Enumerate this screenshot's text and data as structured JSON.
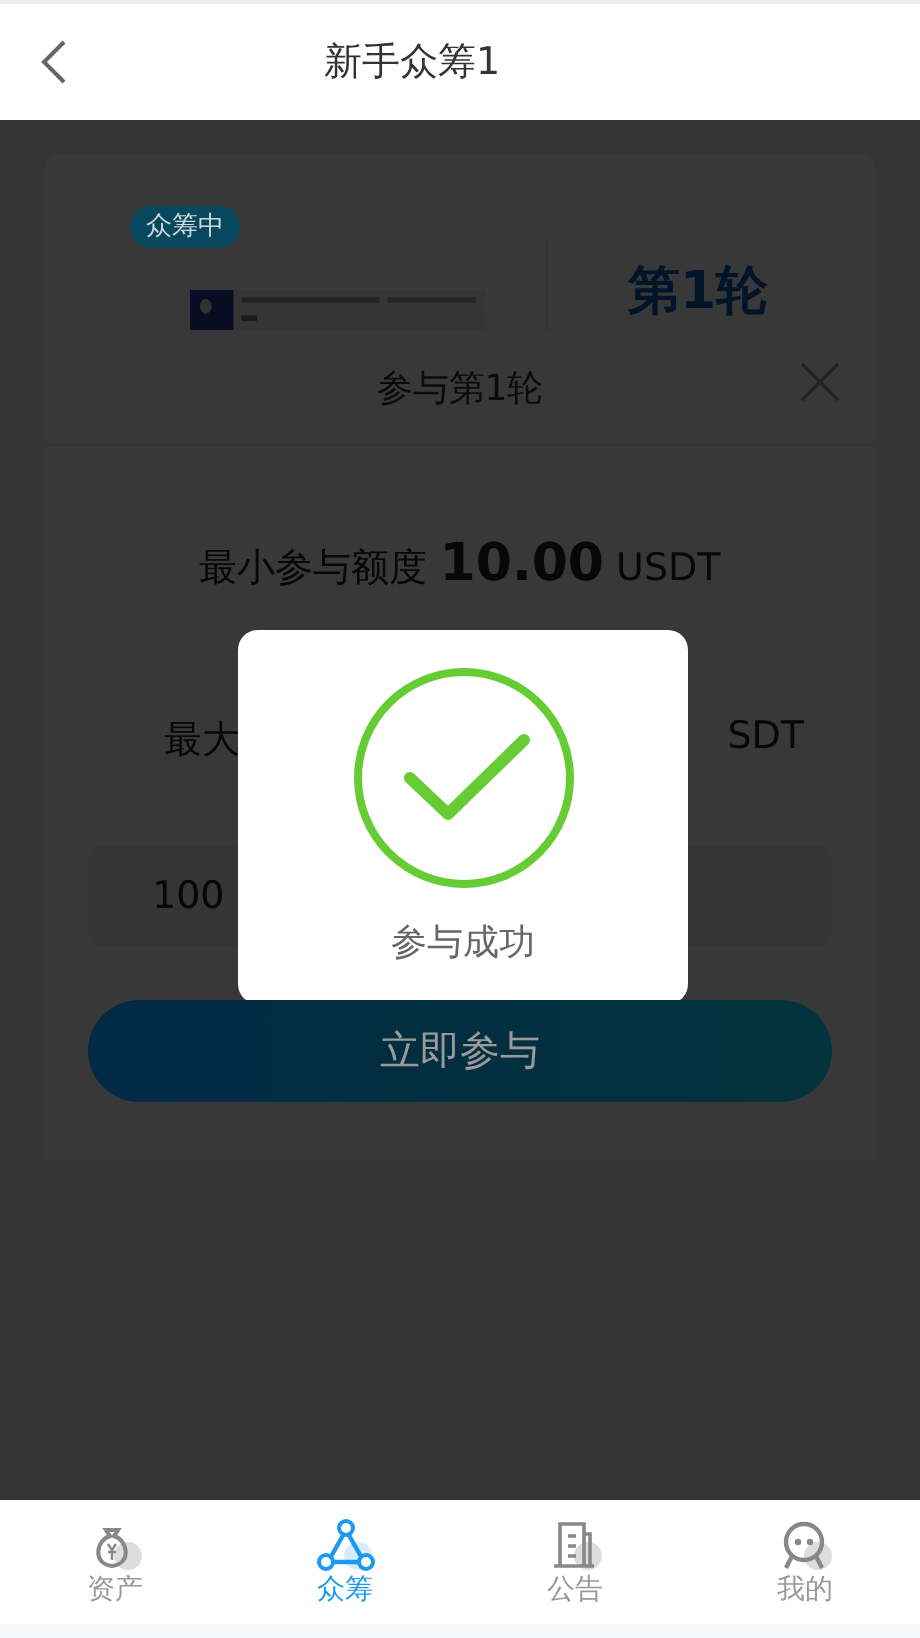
{
  "header": {
    "title": "新手众筹1"
  },
  "card": {
    "badge": "众筹中",
    "round": "第1轮"
  },
  "sheet": {
    "title": "参与第1轮",
    "min": {
      "label": "最小参与额度",
      "amount": "10.00",
      "unit": "USDT"
    },
    "max": {
      "left": "最大",
      "right": "SDT"
    },
    "input": {
      "value": "100"
    },
    "button": "立即参与"
  },
  "toast": {
    "text": "参与成功"
  },
  "tabs": [
    {
      "label": "资产",
      "selected": false
    },
    {
      "label": "众筹",
      "selected": true
    },
    {
      "label": "公告",
      "selected": false
    },
    {
      "label": "我的",
      "selected": false
    }
  ]
}
